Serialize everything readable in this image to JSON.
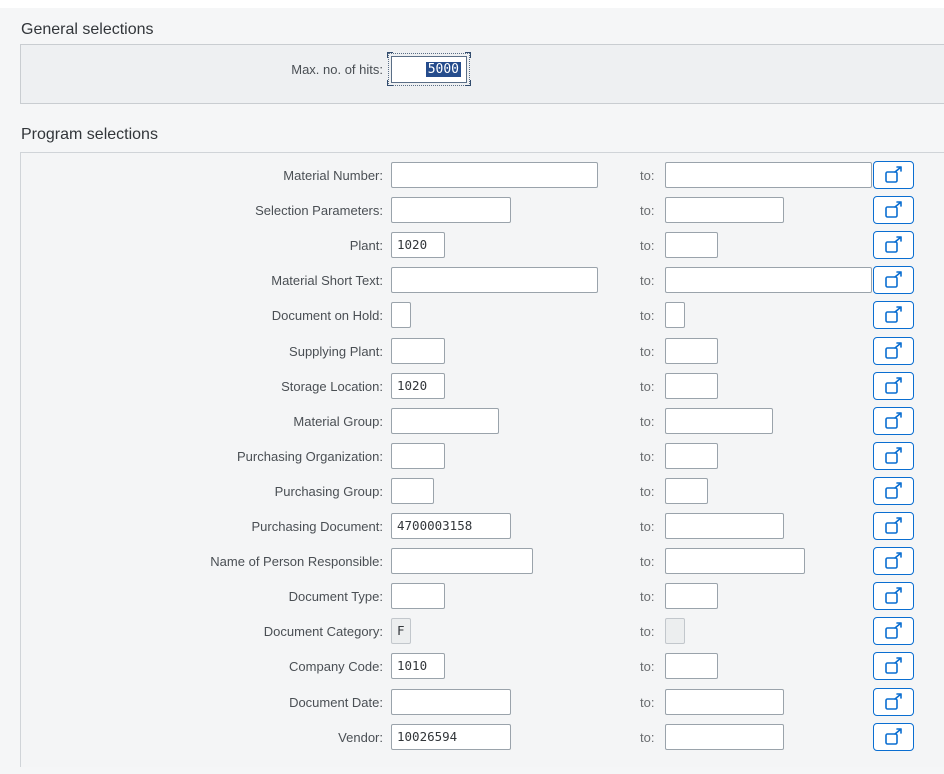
{
  "general": {
    "title": "General selections",
    "max_hits_label": "Max. no. of hits:",
    "max_hits_value": "5000"
  },
  "program": {
    "title": "Program selections",
    "to_label": "to:",
    "multi_icon": "multiple-selection-icon",
    "rows": [
      {
        "label": "Material Number:",
        "from": "",
        "from_width": "wide",
        "to_width": "wide"
      },
      {
        "label": "Selection Parameters:",
        "from": "",
        "from_width": "medium",
        "to_width": "medium"
      },
      {
        "label": "Plant:",
        "from": "1020",
        "from_width": "small",
        "to_width": "small"
      },
      {
        "label": "Material Short Text:",
        "from": "",
        "from_width": "wide",
        "to_width": "wide"
      },
      {
        "label": "Document on Hold:",
        "from": "",
        "from_width": "tiny",
        "to_width": "tiny"
      },
      {
        "label": "Supplying Plant:",
        "from": "",
        "from_width": "small",
        "to_width": "small"
      },
      {
        "label": "Storage Location:",
        "from": "1020",
        "from_width": "small",
        "to_width": "small"
      },
      {
        "label": "Material Group:",
        "from": "",
        "from_width": "medium-small",
        "to_width": "medium-small"
      },
      {
        "label": "Purchasing Organization:",
        "from": "",
        "from_width": "small",
        "to_width": "small"
      },
      {
        "label": "Purchasing Group:",
        "from": "",
        "from_width": "xsmall",
        "to_width": "xsmall"
      },
      {
        "label": "Purchasing Document:",
        "from": "4700003158",
        "from_width": "medium",
        "to_width": "medium"
      },
      {
        "label": "Name of Person Responsible:",
        "from": "",
        "from_width": "medium-large",
        "to_width": "medium-large"
      },
      {
        "label": "Document Type:",
        "from": "",
        "from_width": "small",
        "to_width": "small"
      },
      {
        "label": "Document Category:",
        "from": "F",
        "from_width": "tiny",
        "to_width": "tiny",
        "from_disabled": true,
        "to_disabled": true
      },
      {
        "label": "Company Code:",
        "from": "1010",
        "from_width": "small",
        "to_width": "small"
      },
      {
        "label": "Document Date:",
        "from": "",
        "from_width": "medium",
        "to_width": "medium"
      },
      {
        "label": "Vendor:",
        "from": "10026594",
        "from_width": "medium",
        "to_width": "medium"
      }
    ]
  }
}
